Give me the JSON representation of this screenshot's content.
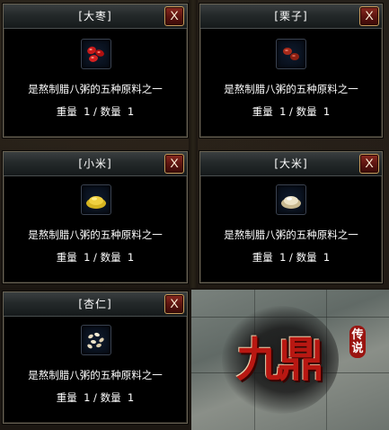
{
  "panels": [
    {
      "title": "[大枣]",
      "close": "X",
      "item_icon": "red-jujube-icon",
      "description": "是熬制腊八粥的五种原料之一",
      "quantity": "重量  1 / 数量  1"
    },
    {
      "title": "[栗子]",
      "close": "X",
      "item_icon": "chestnut-icon",
      "description": "是熬制腊八粥的五种原料之一",
      "quantity": "重量  1 / 数量  1"
    },
    {
      "title": "[小米]",
      "close": "X",
      "item_icon": "millet-pile-icon",
      "description": "是熬制腊八粥的五种原料之一",
      "quantity": "重量  1 / 数量  1"
    },
    {
      "title": "[大米]",
      "close": "X",
      "item_icon": "rice-pile-icon",
      "description": "是熬制腊八粥的五种原料之一",
      "quantity": "重量  1 / 数量  1"
    },
    {
      "title": "[杏仁]",
      "close": "X",
      "item_icon": "almond-icon",
      "description": "是熬制腊八粥的五种原料之一",
      "quantity": "重量  1 / 数量  1"
    }
  ],
  "ad": {
    "logo": "九鼎",
    "subtitle": "传说"
  },
  "colors": {
    "panel_bg": "#000000",
    "title_text": "#ffffff",
    "close_button": "#6e1a14",
    "logo_red": "#b81812"
  }
}
